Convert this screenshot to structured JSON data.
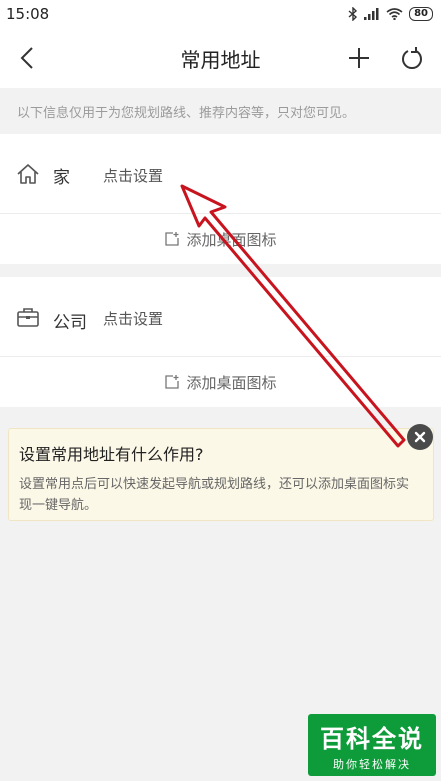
{
  "status_bar": {
    "time": "15:08",
    "battery": "80"
  },
  "nav": {
    "title": "常用地址"
  },
  "notice": "以下信息仅用于为您规划路线、推荐内容等，只对您可见。",
  "home": {
    "label": "家",
    "action": "点击设置",
    "shortcut": "添加桌面图标"
  },
  "company": {
    "label": "公司",
    "action": "点击设置",
    "shortcut": "添加桌面图标"
  },
  "tip": {
    "title": "设置常用地址有什么作用?",
    "body": "设置常用点后可以快速发起导航或规划路线，还可以添加桌面图标实现一键导航。"
  },
  "watermark": {
    "main": "百科全说",
    "sub": "助你轻松解决"
  },
  "colors": {
    "annotation_arrow": "#c8141e",
    "watermark_bg": "#0e9b3a"
  }
}
